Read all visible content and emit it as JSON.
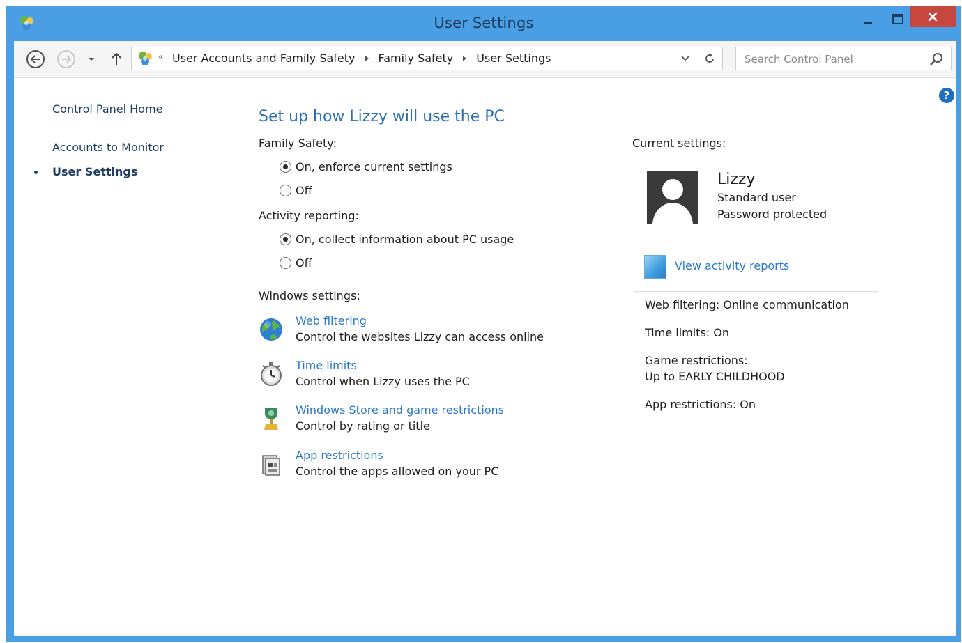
{
  "window": {
    "title": "User Settings",
    "accent_color": "#4a9ee3",
    "close_color": "#c7463d"
  },
  "address_bar": {
    "chevron": "«",
    "breadcrumbs": [
      "User Accounts and Family Safety",
      "Family Safety",
      "User Settings"
    ]
  },
  "search": {
    "placeholder": "Search Control Panel",
    "value": ""
  },
  "sidebar": {
    "items": [
      {
        "label": "Control Panel Home",
        "current": false
      },
      {
        "label": "Accounts to Monitor",
        "current": false
      },
      {
        "label": "User Settings",
        "current": true
      }
    ]
  },
  "main": {
    "heading": "Set up how Lizzy will use the PC",
    "family_safety": {
      "label": "Family Safety:",
      "options": [
        {
          "label": "On, enforce current settings",
          "selected": true
        },
        {
          "label": "Off",
          "selected": false
        }
      ]
    },
    "activity_reporting": {
      "label": "Activity reporting:",
      "options": [
        {
          "label": "On, collect information about PC usage",
          "selected": true
        },
        {
          "label": "Off",
          "selected": false
        }
      ]
    },
    "windows_settings": {
      "label": "Windows settings:",
      "items": [
        {
          "icon": "globe-icon",
          "title": "Web filtering",
          "description": "Control the websites Lizzy can access online"
        },
        {
          "icon": "stopwatch-icon",
          "title": "Time limits",
          "description": "Control when Lizzy uses the PC"
        },
        {
          "icon": "trophy-icon",
          "title": "Windows Store and game restrictions",
          "description": "Control by rating or title"
        },
        {
          "icon": "app-restrictions-icon",
          "title": "App restrictions",
          "description": "Control the apps allowed on your PC"
        }
      ]
    }
  },
  "current_settings": {
    "label": "Current settings:",
    "user": {
      "name": "Lizzy",
      "account_type": "Standard user",
      "password_status": "Password protected"
    },
    "activity_link": "View activity reports",
    "web_filtering": "Web filtering: Online communication",
    "time_limits": "Time limits: On",
    "game_restrictions_label": "Game restrictions:",
    "game_restrictions_value": "Up to EARLY CHILDHOOD",
    "app_restrictions": "App restrictions: On"
  }
}
